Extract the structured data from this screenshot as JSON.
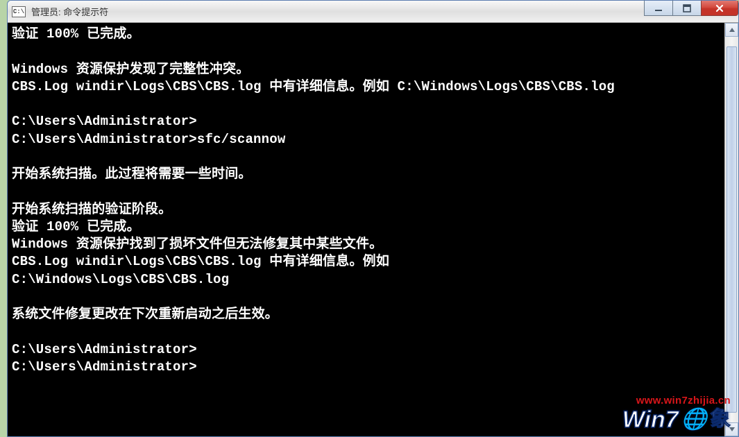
{
  "window": {
    "title": "管理员: 命令提示符",
    "icon_text": "C:\\"
  },
  "console": {
    "lines": [
      "验证 100% 已完成。",
      "",
      "Windows 资源保护发现了完整性冲突。",
      "CBS.Log windir\\Logs\\CBS\\CBS.log 中有详细信息。例如 C:\\Windows\\Logs\\CBS\\CBS.log",
      "",
      "C:\\Users\\Administrator>",
      "C:\\Users\\Administrator>sfc/scannow",
      "",
      "开始系统扫描。此过程将需要一些时间。",
      "",
      "开始系统扫描的验证阶段。",
      "验证 100% 已完成。",
      "Windows 资源保护找到了损坏文件但无法修复其中某些文件。",
      "CBS.Log windir\\Logs\\CBS\\CBS.log 中有详细信息。例如",
      "C:\\Windows\\Logs\\CBS\\CBS.log",
      "",
      "系统文件修复更改在下次重新启动之后生效。",
      "",
      "C:\\Users\\Administrator>",
      "C:\\Users\\Administrator>"
    ]
  },
  "watermark": {
    "url": "www.win7zhijia.cn",
    "logo_text": "Win7",
    "logo_tail": "象"
  }
}
